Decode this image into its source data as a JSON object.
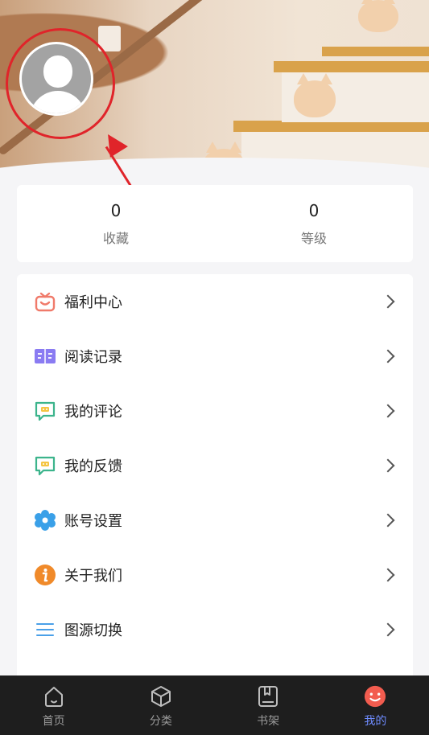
{
  "stats": [
    {
      "value": "0",
      "label": "收藏"
    },
    {
      "value": "0",
      "label": "等级"
    }
  ],
  "menu": [
    {
      "label": "福利中心",
      "icon": "gift-icon",
      "color": "#f07a6a"
    },
    {
      "label": "阅读记录",
      "icon": "book-icon",
      "color": "#8a7bf2"
    },
    {
      "label": "我的评论",
      "icon": "comment-icon",
      "color": "#3cb48c"
    },
    {
      "label": "我的反馈",
      "icon": "feedback-icon",
      "color": "#3cb48c"
    },
    {
      "label": "账号设置",
      "icon": "settings-flower-icon",
      "color": "#3aa0e8"
    },
    {
      "label": "关于我们",
      "icon": "info-icon",
      "color": "#f08a2a"
    },
    {
      "label": "图源切换",
      "icon": "list-icon",
      "color": "#4aa0e8"
    }
  ],
  "tabs": [
    {
      "label": "首页",
      "icon": "home-icon",
      "active": false
    },
    {
      "label": "分类",
      "icon": "cube-icon",
      "active": false
    },
    {
      "label": "书架",
      "icon": "bookshelf-icon",
      "active": false
    },
    {
      "label": "我的",
      "icon": "smiley-icon",
      "active": true
    }
  ],
  "colors": {
    "accent": "#6f8cff",
    "annotation": "#e0242a",
    "tabbar_bg": "#1e1e1e"
  }
}
